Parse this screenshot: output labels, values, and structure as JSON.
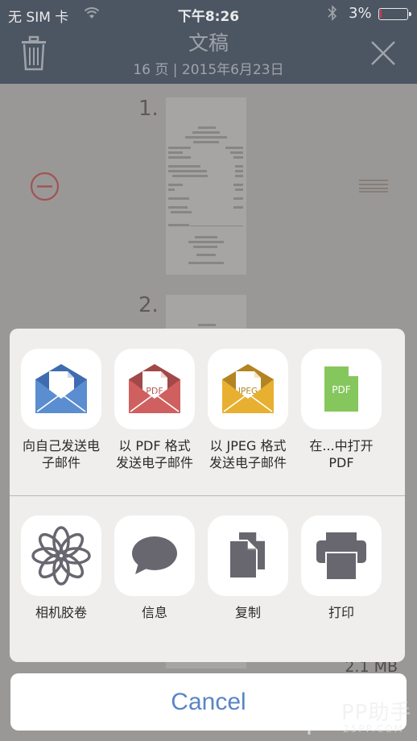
{
  "status_bar": {
    "carrier": "无 SIM 卡",
    "time": "下午8:26",
    "battery_percent": "3%",
    "battery_level": 0.03
  },
  "header": {
    "title": "文稿",
    "subtitle": "16 页  |  2015年6月23日",
    "trash_icon": "trash-icon",
    "close_icon": "close-icon"
  },
  "document": {
    "pages": [
      {
        "number": "1."
      },
      {
        "number": "2."
      }
    ],
    "file_size": "2.1 MB"
  },
  "share_sheet": {
    "row1": [
      {
        "label": "向自己发送电\n子邮件",
        "icon": "email-self-icon",
        "color": "#4a7cc4"
      },
      {
        "label": "以 PDF 格式\n发送电子邮件",
        "icon": "email-pdf-icon",
        "color": "#cf5a5a",
        "badge": "PDF"
      },
      {
        "label": "以 JPEG 格式\n发送电子邮件",
        "icon": "email-jpeg-icon",
        "color": "#e6ad2a",
        "badge": "JPEG"
      },
      {
        "label": "在...中打开\nPDF",
        "icon": "open-pdf-icon",
        "color": "#86c75d",
        "badge": "PDF"
      }
    ],
    "row2": [
      {
        "label": "相机胶卷",
        "icon": "camera-roll-icon"
      },
      {
        "label": "信息",
        "icon": "message-icon"
      },
      {
        "label": "复制",
        "icon": "copy-icon"
      },
      {
        "label": "打印",
        "icon": "print-icon"
      }
    ],
    "icon_gray": "#68676f"
  },
  "cancel_label": "Cancel",
  "watermark": {
    "brand": "PP助手",
    "site": "25PP.COM"
  }
}
